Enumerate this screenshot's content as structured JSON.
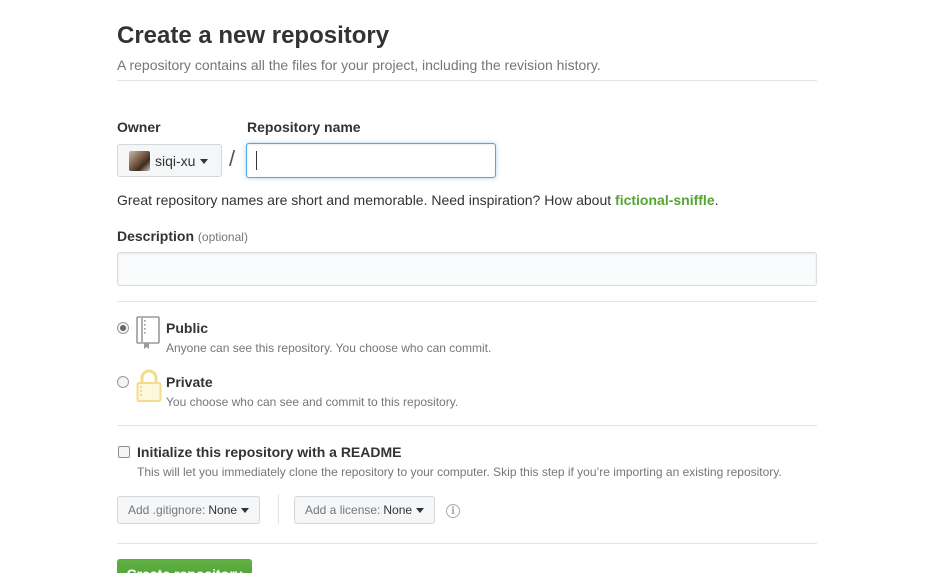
{
  "header": {
    "title": "Create a new repository",
    "subtitle": "A repository contains all the files for your project, including the revision history."
  },
  "owner": {
    "label": "Owner",
    "value": "siqi-xu"
  },
  "repo_name": {
    "label": "Repository name",
    "separator": "/",
    "value": "",
    "placeholder": ""
  },
  "hint": {
    "prefix": "Great repository names are short and memorable. Need inspiration? How about ",
    "suggestion": "fictional-sniffle",
    "suffix": "."
  },
  "description": {
    "label": "Description",
    "optional": "(optional)",
    "value": ""
  },
  "visibility": {
    "selected": "public",
    "public": {
      "title": "Public",
      "note": "Anyone can see this repository. You choose who can commit."
    },
    "private": {
      "title": "Private",
      "note": "You choose who can see and commit to this repository."
    }
  },
  "readme": {
    "checked": false,
    "title": "Initialize this repository with a README",
    "note": "This will let you immediately clone the repository to your computer. Skip this step if you’re importing an existing repository."
  },
  "gitignore": {
    "label": "Add .gitignore:",
    "value": "None"
  },
  "license": {
    "label": "Add a license:",
    "value": "None"
  },
  "info_glyph": "i",
  "create_button": {
    "label": "Create repository"
  },
  "colors": {
    "suggestion": "#55a532",
    "focus_border": "#51a7e8",
    "create_button": "#55a532",
    "private_lock": "#f3dd8c"
  },
  "icons": {
    "owner_dropdown": "caret-down-icon",
    "public": "repo-book-icon",
    "private": "lock-icon",
    "license_info": "info-icon"
  }
}
